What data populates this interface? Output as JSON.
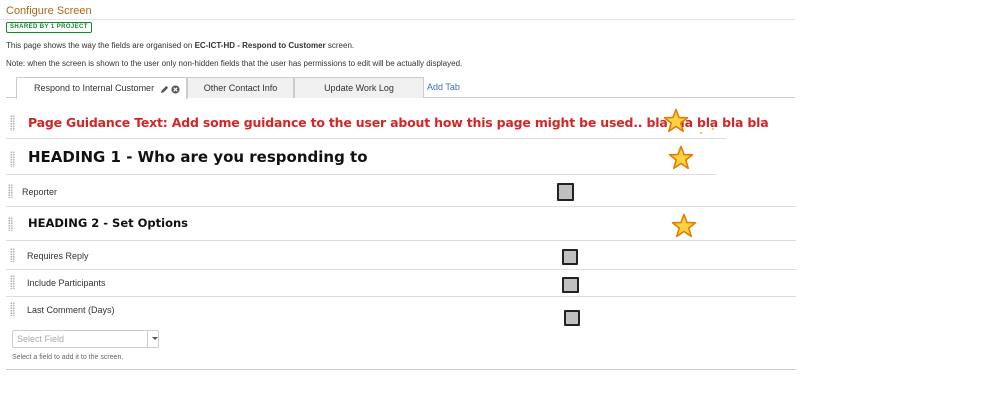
{
  "page": {
    "title": "Configure Screen",
    "shared_badge": "SHARED BY 1 PROJECT",
    "desc1_prefix": "This page shows the way the fields are organised on ",
    "desc1_screen": "EC-ICT-HD - Respond to Customer",
    "desc1_suffix": " screen.",
    "desc2": "Note: when the screen is shown to the user only non-hidden fields that the user has permissions to edit will be actually displayed."
  },
  "tabs": [
    {
      "label": "Respond to Internal Customer",
      "active": true
    },
    {
      "label": "Other Contact Info",
      "active": false
    },
    {
      "label": "Update Work Log",
      "active": false
    }
  ],
  "add_tab_label": "Add Tab",
  "fields": {
    "guidance": "Page Guidance Text: Add some guidance to the user about how this page might be used.. bla bla bla bla bla",
    "heading1": "HEADING 1 - Who are you responding to",
    "reporter": "Reporter",
    "heading2": "HEADING 2 - Set Options",
    "requires_reply": "Requires Reply",
    "include_participants": "Include Participants",
    "last_comment": "Last Comment (Days)"
  },
  "select_field": {
    "placeholder": "Select Field",
    "help": "Select a field to add it to the screen."
  },
  "icons": {
    "star": "star-icon",
    "checkbox": "checkbox-icon",
    "edit": "pencil-icon",
    "remove": "remove-icon",
    "drag": "drag-handle-icon",
    "dropdown": "chevron-down-icon"
  },
  "colors": {
    "title": "#b5651d",
    "badge": "#14892c",
    "guidance_text": "#d42626",
    "link": "#3b73af",
    "star_fill": "#ffd23f",
    "star_stroke": "#e57a00",
    "checkbox_fill": "#c0c0c0"
  }
}
